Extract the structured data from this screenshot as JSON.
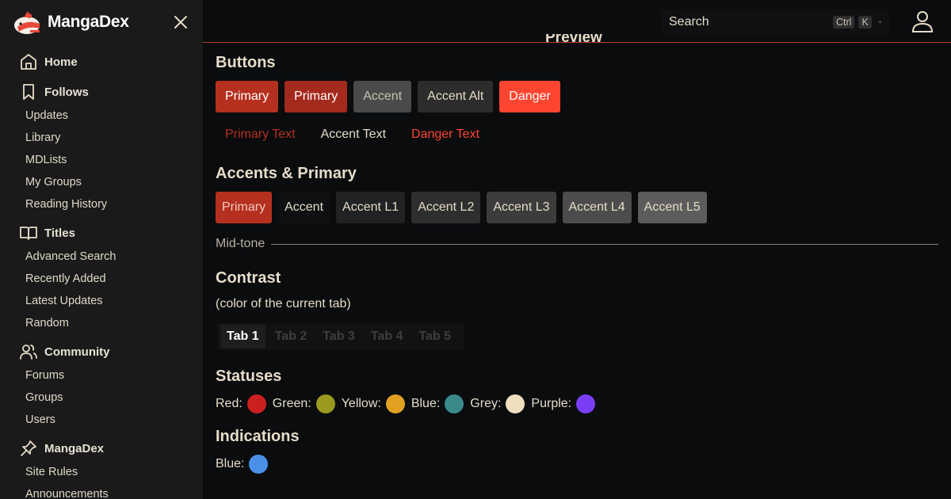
{
  "brand": {
    "name": "MangaDex"
  },
  "sidebar": {
    "sections": [
      {
        "label": "Home",
        "icon": "home-icon",
        "items": []
      },
      {
        "label": "Follows",
        "icon": "bookmark-icon",
        "items": [
          "Updates",
          "Library",
          "MDLists",
          "My Groups",
          "Reading History"
        ]
      },
      {
        "label": "Titles",
        "icon": "book-open-icon",
        "items": [
          "Advanced Search",
          "Recently Added",
          "Latest Updates",
          "Random"
        ]
      },
      {
        "label": "Community",
        "icon": "users-icon",
        "items": [
          "Forums",
          "Groups",
          "Users"
        ]
      },
      {
        "label": "MangaDex",
        "icon": "pin-icon",
        "items": [
          "Site Rules",
          "Announcements"
        ]
      }
    ]
  },
  "header": {
    "search_placeholder": "Search",
    "kbd_ctrl": "Ctrl",
    "kbd_k": "K"
  },
  "main": {
    "preview_title": "Preview",
    "buttons_heading": "Buttons",
    "buttons": [
      {
        "label": "Primary",
        "bg": "#b5301f",
        "fg": "#ffffff"
      },
      {
        "label": "Primary",
        "bg": "#a52a1e",
        "fg": "#ffffff"
      },
      {
        "label": "Accent",
        "bg": "#4a4a4a",
        "fg": "#c8c0b0"
      },
      {
        "label": "Accent Alt",
        "bg": "#2c2c2c",
        "fg": "#e6dcc8"
      },
      {
        "label": "Danger",
        "bg": "#ff4530",
        "fg": "#ffffff"
      }
    ],
    "text_buttons": [
      {
        "label": "Primary Text",
        "fg": "#b5301f"
      },
      {
        "label": "Accent Text",
        "fg": "#e6dcc8"
      },
      {
        "label": "Danger Text",
        "fg": "#ff4530"
      }
    ],
    "accents_heading": "Accents & Primary",
    "accents": [
      {
        "label": "Primary",
        "bg": "#b5301f",
        "fg": "#f0c8c0"
      },
      {
        "label": "Accent",
        "bg": "#0e1012",
        "fg": "#e6dcc8"
      },
      {
        "label": "Accent L1",
        "bg": "#202224",
        "fg": "#e6dcc8"
      },
      {
        "label": "Accent L2",
        "bg": "#2e2e2e",
        "fg": "#e6dcc8"
      },
      {
        "label": "Accent L3",
        "bg": "#3c3c3c",
        "fg": "#e6dcc8"
      },
      {
        "label": "Accent L4",
        "bg": "#4c4c4c",
        "fg": "#e6dcc8"
      },
      {
        "label": "Accent L5",
        "bg": "#5c5c5c",
        "fg": "#e6dcc8"
      }
    ],
    "midtone_label": "Mid-tone",
    "contrast_heading": "Contrast",
    "contrast_sub": "(color of the current tab)",
    "tabs": [
      "Tab 1",
      "Tab 2",
      "Tab 3",
      "Tab 4",
      "Tab 5"
    ],
    "statuses_heading": "Statuses",
    "statuses": [
      {
        "label": "Red:",
        "color": "#cc2020"
      },
      {
        "label": "Green:",
        "color": "#9a9a1e"
      },
      {
        "label": "Yellow:",
        "color": "#e0a020"
      },
      {
        "label": "Blue:",
        "color": "#3a8a8a"
      },
      {
        "label": "Grey:",
        "color": "#efdfbf"
      },
      {
        "label": "Purple:",
        "color": "#7a3ff5"
      }
    ],
    "indications_heading": "Indications",
    "indications": [
      {
        "label": "Blue:",
        "color": "#4a90e8"
      }
    ]
  }
}
